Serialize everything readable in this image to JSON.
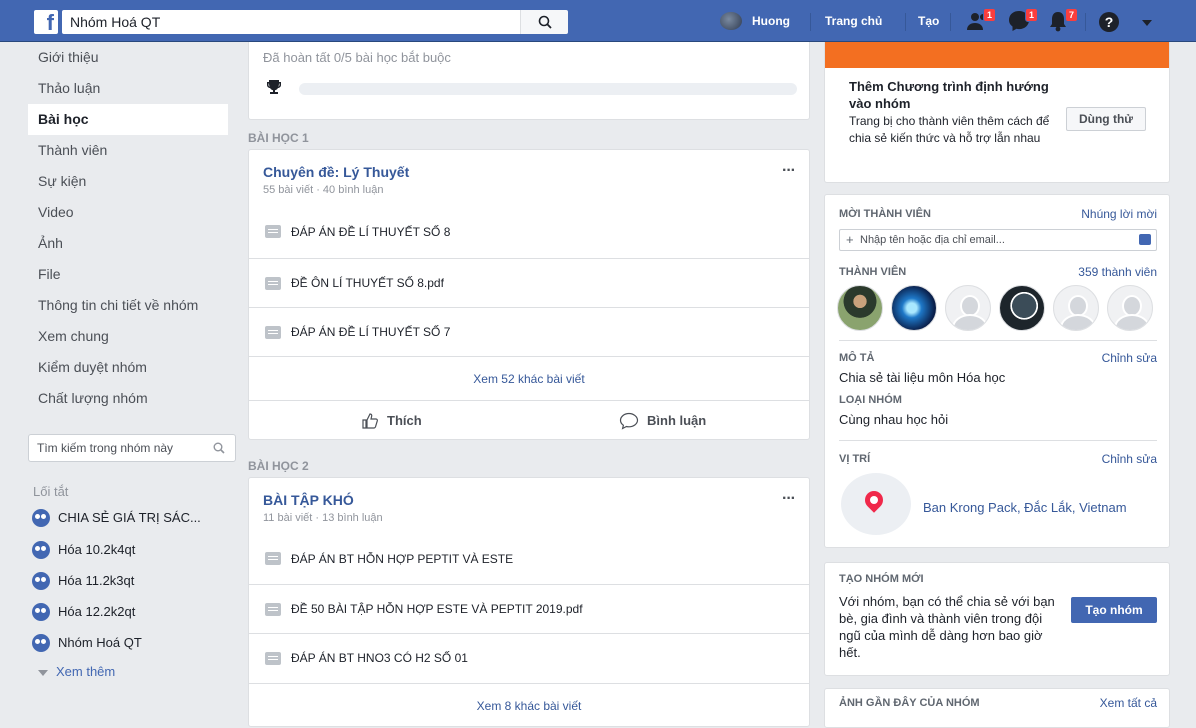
{
  "topbar": {
    "search_value": "Nhóm Hoá QT",
    "profile_name": "Huong",
    "home_label": "Trang chủ",
    "create_label": "Tạo",
    "friend_requests_count": "1",
    "messages_count": "1",
    "notifications_count": "7",
    "help_glyph": "?"
  },
  "left_nav": {
    "items": [
      "Giới thiệu",
      "Thảo luận",
      "Bài học",
      "Thành viên",
      "Sự kiện",
      "Video",
      "Ảnh",
      "File",
      "Thông tin chi tiết về nhóm",
      "Xem chung",
      "Kiểm duyệt nhóm",
      "Chất lượng nhóm"
    ],
    "active": "Bài học",
    "search_placeholder": "Tìm kiếm trong nhóm này",
    "shortcuts_title": "Lối tắt",
    "shortcuts": [
      "CHIA SẺ GIÁ TRỊ SÁC...",
      "Hóa 10.2k4qt",
      "Hóa 11.2k3qt",
      "Hóa 12.2k2qt",
      "Nhóm Hoá QT"
    ],
    "see_more": "Xem thêm"
  },
  "progress": {
    "text": "Đã hoàn tất 0/5 bài học bắt buộc",
    "fraction_complete": 0
  },
  "lessons": [
    {
      "section": "BÀI HỌC 1",
      "title": "Chuyên đề: Lý Thuyết",
      "meta": "55 bài viết · 40 bình luận",
      "posts": [
        "ĐÁP ÁN ĐỀ LÍ THUYẾT SỐ 8",
        "ĐỀ ÔN LÍ THUYẾT SỐ 8.pdf",
        "ĐÁP ÁN ĐỀ LÍ THUYẾT SỐ 7"
      ],
      "see_more": "Xem 52 khác bài viết",
      "like_label": "Thích",
      "comment_label": "Bình luận"
    },
    {
      "section": "BÀI HỌC 2",
      "title": "BÀI TẬP KHÓ",
      "meta": "11 bài viết · 13 bình luận",
      "posts": [
        "ĐÁP ÁN BT HỖN HỢP PEPTIT VÀ ESTE",
        "ĐỀ 50 BÀI TẬP HỖN HỢP ESTE VÀ PEPTIT 2019.pdf",
        "ĐÁP ÁN BT HNO3 CÓ H2 SỐ 01"
      ],
      "see_more": "Xem 8 khác bài viết"
    }
  ],
  "promo": {
    "title": "Thêm Chương trình định hướng vào nhóm",
    "desc": "Trang bị cho thành viên thêm cách để chia sẻ kiến thức và hỗ trợ lẫn nhau",
    "button": "Dùng thử"
  },
  "info": {
    "invite_label": "MỜI THÀNH VIÊN",
    "invite_link": "Nhúng lời mời",
    "invite_placeholder": "Nhập tên hoặc địa chỉ email...",
    "members_label": "THÀNH VIÊN",
    "members_count": "359 thành viên",
    "desc_label": "MÔ TẢ",
    "desc_edit": "Chỉnh sửa",
    "desc_text": "Chia sẻ tài liệu môn Hóa học",
    "type_label": "LOẠI NHÓM",
    "type_text": "Cùng nhau học hỏi",
    "location_label": "VỊ TRÍ",
    "location_edit": "Chỉnh sửa",
    "location_text": "Ban Krong Pack, Đắc Lắk, Vietnam"
  },
  "create_group": {
    "label": "TẠO NHÓM MỚI",
    "desc": "Với nhóm, bạn có thể chia sẻ với bạn bè, gia đình và thành viên trong đội ngũ của mình dễ dàng hơn bao giờ hết.",
    "button": "Tạo nhóm"
  },
  "recent_photos": {
    "label": "ẢNH GẦN ĐÂY CỦA NHÓM",
    "link": "Xem tất cả"
  },
  "colors": {
    "brand": "#4267b2",
    "link": "#365899",
    "badge": "#fa3e3e",
    "promo_banner": "#f36f21"
  }
}
